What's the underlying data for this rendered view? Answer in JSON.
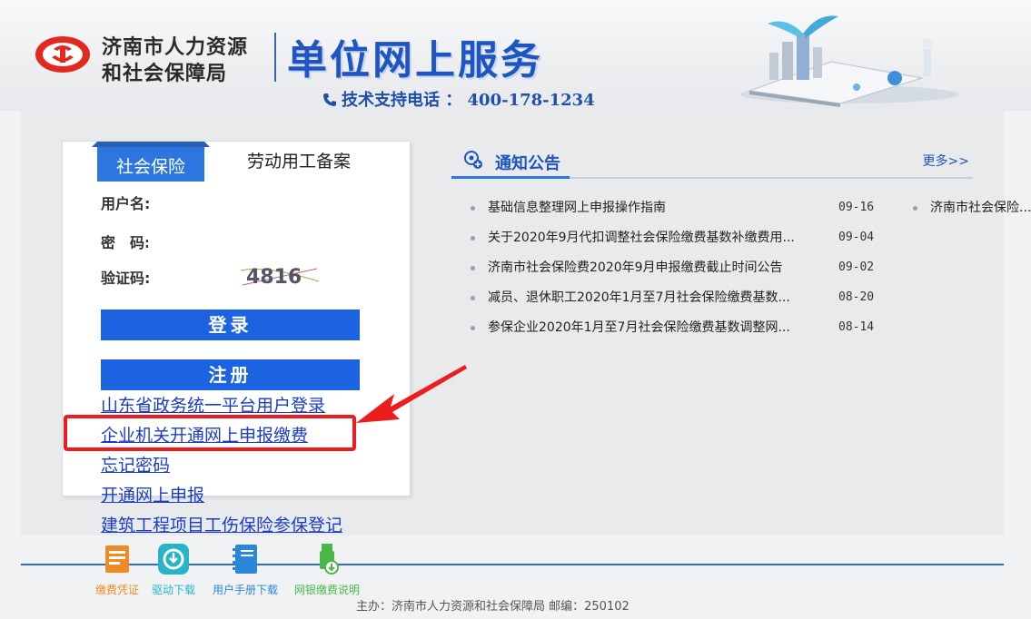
{
  "header": {
    "org_line1": "济南市人力资源",
    "org_line2": "和社会保障局",
    "site_title": "单位网上服务",
    "hotline": "技术支持电话 ： 400-178-1234"
  },
  "login": {
    "tabs": [
      {
        "label": "社会保险",
        "active": true
      },
      {
        "label": "劳动用工备案",
        "active": false
      }
    ],
    "fields": {
      "username_label": "用户名:",
      "username_value": "",
      "password_label": "密　码:",
      "password_value": "",
      "captcha_label": "验证码:",
      "captcha_value": "",
      "captcha_text": "4816"
    },
    "login_button": "登录",
    "register_button": "注册",
    "links": [
      "山东省政务统一平台用户登录",
      "企业机关开通网上申报缴费",
      "忘记密码",
      "开通网上申报",
      "建筑工程项目工伤保险参保登记"
    ]
  },
  "notices": {
    "title": "通知公告",
    "more": "更多>>",
    "items": [
      {
        "title": "基础信息整理网上申报操作指南",
        "date": "09-16"
      },
      {
        "title": "关于2020年9月代扣调整社会保险缴费基数补缴费用...",
        "date": "09-04"
      },
      {
        "title": "济南市社会保险费2020年9月申报缴费截止时间公告",
        "date": "09-02"
      },
      {
        "title": "减员、退休职工2020年1月至7月社会保险缴费基数...",
        "date": "08-20"
      },
      {
        "title": "参保企业2020年1月至7月社会保险缴费基数调整网...",
        "date": "08-14"
      }
    ],
    "side_item": "济南市社会保险..."
  },
  "tools": [
    {
      "label": "缴费凭证",
      "icon": "receipt-icon",
      "color": "#f08a24"
    },
    {
      "label": "驱动下载",
      "icon": "driver-download-icon",
      "color": "#27b3c9"
    },
    {
      "label": "用户手册下载",
      "icon": "manual-icon",
      "color": "#2b87d8"
    },
    {
      "label": "网银缴费说明",
      "icon": "usb-key-icon",
      "color": "#49b848"
    }
  ],
  "footer": {
    "text": "主办：济南市人力资源和社会保障局  邮编：250102"
  },
  "colors": {
    "primary_blue": "#1b63e0",
    "tab_blue": "#2d76e0",
    "highlight_red": "#ee1d1d",
    "link_blue": "#1a3cc9"
  }
}
